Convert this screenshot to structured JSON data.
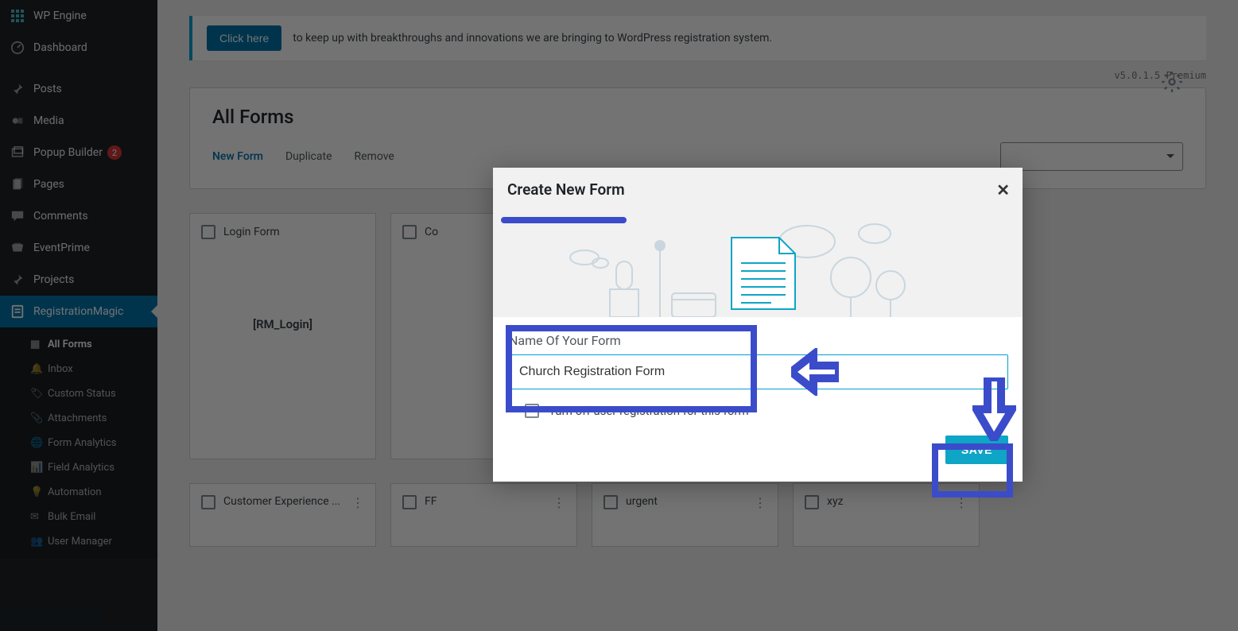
{
  "sidebar": {
    "items": [
      {
        "label": "WP Engine"
      },
      {
        "label": "Dashboard"
      },
      {
        "label": "Posts"
      },
      {
        "label": "Media"
      },
      {
        "label": "Popup Builder",
        "badge": "2"
      },
      {
        "label": "Pages"
      },
      {
        "label": "Comments"
      },
      {
        "label": "EventPrime"
      },
      {
        "label": "Projects"
      },
      {
        "label": "RegistrationMagic"
      }
    ],
    "sub": [
      {
        "label": "All Forms"
      },
      {
        "label": "Inbox"
      },
      {
        "label": "Custom Status"
      },
      {
        "label": "Attachments"
      },
      {
        "label": "Form Analytics"
      },
      {
        "label": "Field Analytics"
      },
      {
        "label": "Automation"
      },
      {
        "label": "Bulk Email"
      },
      {
        "label": "User Manager"
      }
    ]
  },
  "notice": {
    "button": "Click here",
    "text": "to keep up with breakthroughs and innovations we are bringing to WordPress registration system."
  },
  "version": "v5.0.1.5 Premium",
  "panel": {
    "title": "All Forms",
    "actions": [
      "New Form",
      "Duplicate",
      "Remove"
    ]
  },
  "cards": [
    {
      "title": "Login Form",
      "shortcode": "[RM_Login]"
    },
    {
      "title": "Co"
    }
  ],
  "cards2": [
    {
      "title": "Customer Experience ..."
    },
    {
      "title": "FF"
    },
    {
      "title": "urgent"
    },
    {
      "title": "xyz"
    }
  ],
  "modal": {
    "title": "Create New Form",
    "form_label": "Name Of Your Form",
    "form_value": "Church Registration Form",
    "checkbox_label": "Turn off user registration for this form",
    "save": "SAVE"
  }
}
